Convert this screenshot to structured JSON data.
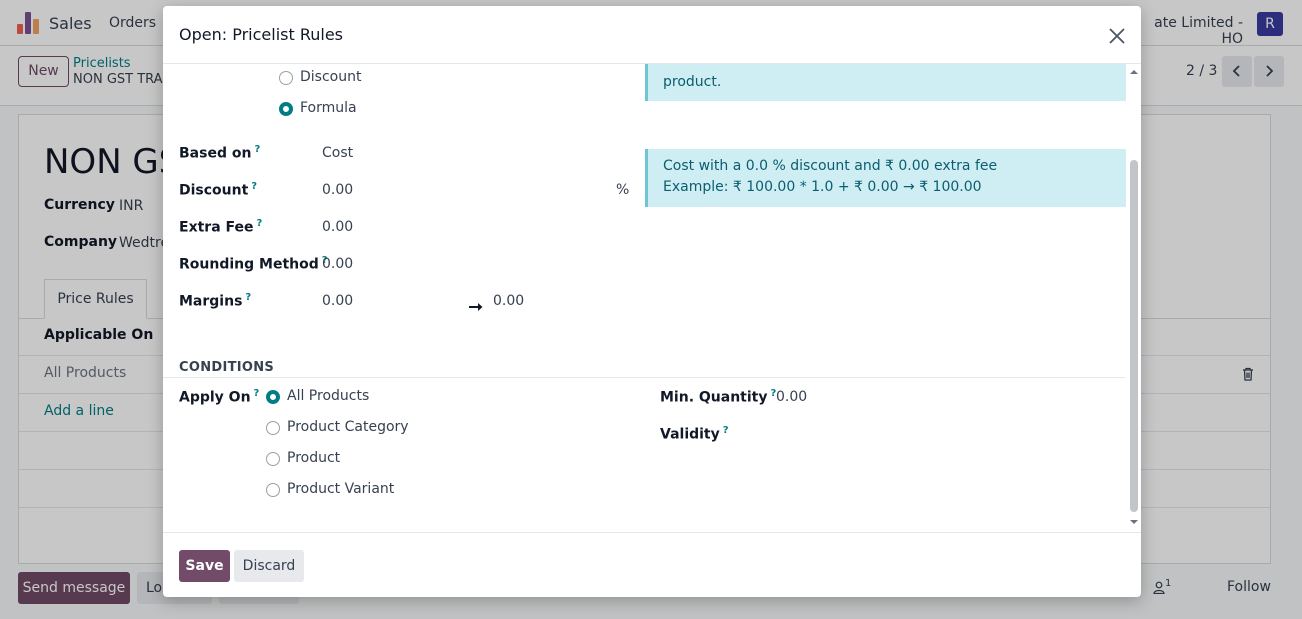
{
  "navbar": {
    "app_name": "Sales",
    "menu_orders": "Orders",
    "company_name": "ate Limited - HO",
    "avatar_letter": "R"
  },
  "control_panel": {
    "new_label": "New",
    "breadcrumb_parent": "Pricelists",
    "breadcrumb_current": "NON GST TRA",
    "pager": "2 / 3"
  },
  "form": {
    "record_name": "NON GS",
    "currency_label": "Currency",
    "currency_value": "INR",
    "company_label": "Company",
    "company_value": "Wedtre",
    "tab_price_rules": "Price Rules",
    "col_applicable_on": "Applicable On",
    "row_all_products": "All Products",
    "add_line": "Add a line"
  },
  "chatter": {
    "send_message": "Send message",
    "log_note": "Lo",
    "followers_count": "1",
    "follow": "Follow"
  },
  "modal": {
    "title": "Open: Pricelist Rules",
    "price_type": {
      "options": [
        "Discount",
        "Formula"
      ],
      "selected": "Formula"
    },
    "alert_top_text": "product.",
    "alert_formula_line1": "Cost with a 0.0 % discount and ₹ 0.00 extra fee",
    "alert_formula_line2": "Example: ₹ 100.00 * 1.0 + ₹ 0.00 → ₹ 100.00",
    "fields": {
      "based_on_label": "Based on",
      "based_on_value": "Cost",
      "discount_label": "Discount",
      "discount_value": "0.00",
      "discount_unit": "%",
      "extra_fee_label": "Extra Fee",
      "extra_fee_value": "0.00",
      "rounding_label": "Rounding Method",
      "rounding_value": "0.00",
      "margins_label": "Margins",
      "margin_min": "0.00",
      "margin_max": "0.00",
      "help_mark": "?"
    },
    "conditions": {
      "section_title": "CONDITIONS",
      "apply_on_label": "Apply On",
      "apply_on_options": [
        "All Products",
        "Product Category",
        "Product",
        "Product Variant"
      ],
      "apply_on_selected": "All Products",
      "min_qty_label": "Min. Quantity",
      "min_qty_value": "0.00",
      "validity_label": "Validity"
    },
    "footer": {
      "save": "Save",
      "discard": "Discard"
    }
  }
}
